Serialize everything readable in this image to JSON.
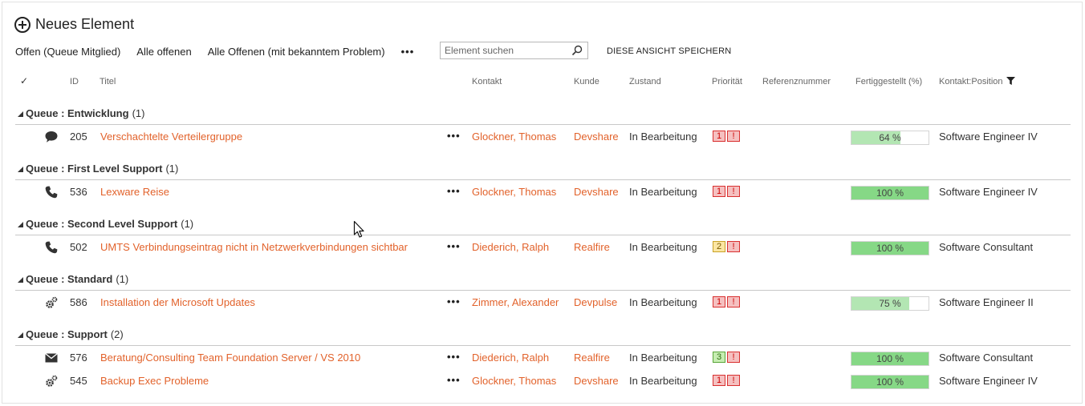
{
  "toolbar": {
    "new_item_label": "Neues Element",
    "save_view_label": "DIESE ANSICHT SPEICHERN"
  },
  "views": [
    "Offen (Queue Mitglied)",
    "Alle offenen",
    "Alle Offenen (mit bekanntem Problem)"
  ],
  "views_more": "•••",
  "search": {
    "placeholder": "Element suchen",
    "value": ""
  },
  "columns": {
    "check": "✓",
    "id": "ID",
    "title": "Titel",
    "contact": "Kontakt",
    "customer": "Kunde",
    "state": "Zustand",
    "priority": "Priorität",
    "reference": "Referenznummer",
    "completed": "Fertiggestellt (%)",
    "contact_position": "Kontakt:Position"
  },
  "colors": {
    "link": "#e2622b",
    "progress_full": "#86d886",
    "progress_partial": "#b3e6b3",
    "prio_red": "#f5c0c0",
    "prio_yellow": "#fbe6a3",
    "prio_green": "#c6edb2"
  },
  "row_more": "•••",
  "groups": [
    {
      "name": "Queue : Entwicklung",
      "count": "(1)",
      "rows": [
        {
          "icon": "comment-icon",
          "id": "205",
          "title": "Verschachtelte Verteilergruppe",
          "contact": "Glockner, Thomas",
          "customer": "Devshare",
          "state": "In Bearbeitung",
          "priority": "1",
          "priority_level": "red",
          "flag": "!",
          "progress": 64,
          "progress_label": "64 %",
          "position": "Software Engineer IV"
        }
      ]
    },
    {
      "name": "Queue : First Level Support",
      "count": "(1)",
      "rows": [
        {
          "icon": "phone-icon",
          "id": "536",
          "title": "Lexware Reise",
          "contact": "Glockner, Thomas",
          "customer": "Devshare",
          "state": "In Bearbeitung",
          "priority": "1",
          "priority_level": "red",
          "flag": "!",
          "progress": 100,
          "progress_label": "100 %",
          "position": "Software Engineer IV"
        }
      ]
    },
    {
      "name": "Queue : Second Level Support",
      "count": "(1)",
      "rows": [
        {
          "icon": "phone-icon",
          "id": "502",
          "title": "UMTS Verbindungseintrag nicht in Netzwerkverbindungen sichtbar",
          "contact": "Diederich, Ralph",
          "customer": "Realfire",
          "state": "In Bearbeitung",
          "priority": "2",
          "priority_level": "yellow",
          "flag": "!",
          "progress": 100,
          "progress_label": "100 %",
          "position": "Software Consultant"
        }
      ]
    },
    {
      "name": "Queue : Standard",
      "count": "(1)",
      "rows": [
        {
          "icon": "gears-icon",
          "id": "586",
          "title": "Installation der Microsoft Updates",
          "contact": "Zimmer, Alexander",
          "customer": "Devpulse",
          "state": "In Bearbeitung",
          "priority": "1",
          "priority_level": "red",
          "flag": "!",
          "progress": 75,
          "progress_label": "75 %",
          "position": "Software Engineer II"
        }
      ]
    },
    {
      "name": "Queue : Support",
      "count": "(2)",
      "rows": [
        {
          "icon": "envelope-icon",
          "id": "576",
          "title": "Beratung/Consulting Team Foundation Server / VS 2010",
          "contact": "Diederich, Ralph",
          "customer": "Realfire",
          "state": "In Bearbeitung",
          "priority": "3",
          "priority_level": "green",
          "flag": "!",
          "progress": 100,
          "progress_label": "100 %",
          "position": "Software Consultant"
        },
        {
          "icon": "gears-icon",
          "id": "545",
          "title": "Backup Exec Probleme",
          "contact": "Glockner, Thomas",
          "customer": "Devshare",
          "state": "In Bearbeitung",
          "priority": "1",
          "priority_level": "red",
          "flag": "!",
          "progress": 100,
          "progress_label": "100 %",
          "position": "Software Engineer IV"
        }
      ]
    }
  ]
}
